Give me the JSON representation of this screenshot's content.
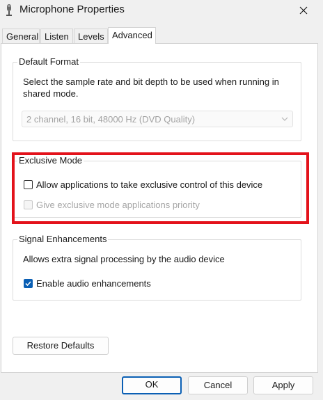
{
  "window": {
    "title": "Microphone Properties"
  },
  "tabs": [
    {
      "label": "General"
    },
    {
      "label": "Listen"
    },
    {
      "label": "Levels"
    },
    {
      "label": "Advanced"
    }
  ],
  "default_format": {
    "heading": "Default Format",
    "description_line1": "Select the sample rate and bit depth to be used when running in",
    "description_line2": "shared mode.",
    "selected_format": "2 channel, 16 bit, 48000 Hz (DVD Quality)"
  },
  "exclusive_mode": {
    "heading": "Exclusive Mode",
    "allow_label": "Allow applications to take exclusive control of this device",
    "allow_checked": false,
    "priority_label": "Give exclusive mode applications priority",
    "priority_checked": false,
    "priority_enabled": false
  },
  "signal_enhancements": {
    "heading": "Signal Enhancements",
    "description": "Allows extra signal processing by the audio device",
    "enable_label": "Enable audio enhancements",
    "enable_checked": true
  },
  "buttons": {
    "restore_defaults": "Restore Defaults",
    "ok": "OK",
    "cancel": "Cancel",
    "apply": "Apply"
  },
  "colors": {
    "accent": "#0a5fb4",
    "highlight_box": "#e3121b"
  },
  "icons": {
    "title": "microphone-icon",
    "close": "close-icon",
    "combo": "chevron-down-icon",
    "check": "checkmark-icon"
  }
}
